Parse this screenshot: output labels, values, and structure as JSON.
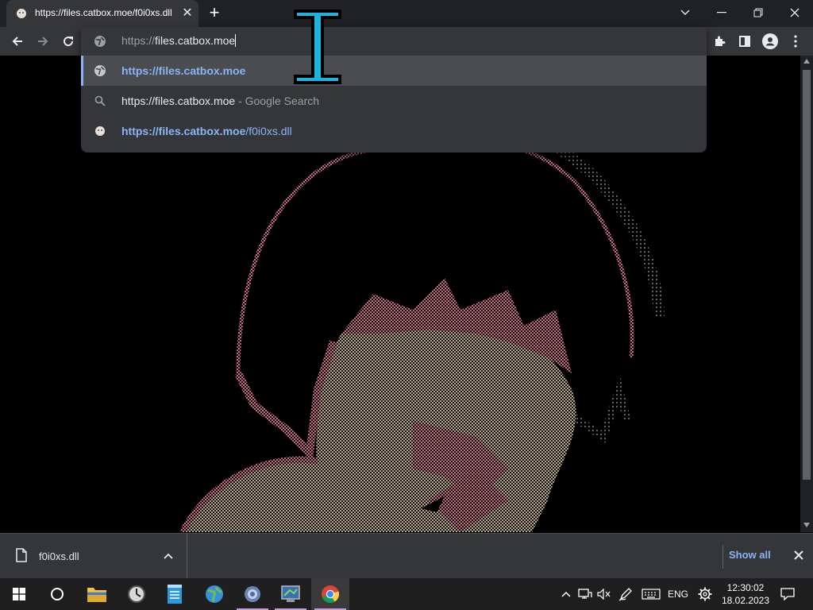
{
  "tab": {
    "title": "https://files.catbox.moe/f0i0xs.dll",
    "close_icon": "close-icon"
  },
  "omnibox": {
    "input_prefix": "https://",
    "input_main": "files.catbox.moe",
    "suggestions": [
      {
        "kind": "url",
        "icon": "globe-icon",
        "text": "https://files.catbox.moe",
        "suffix": "",
        "selected": true
      },
      {
        "kind": "search",
        "icon": "search-icon",
        "text": "https://files.catbox.moe",
        "suffix": " - Google Search",
        "selected": false
      },
      {
        "kind": "history",
        "icon": "catbox-favicon",
        "text_bold": "https://files.catbox.moe",
        "text_rest": "/f0i0xs.dll",
        "selected": false
      }
    ]
  },
  "downloads": {
    "file_name": "f0i0xs.dll",
    "show_all": "Show all"
  },
  "taskbar": {
    "lang": "ENG",
    "time": "12:30:02",
    "date": "18.02.2023"
  },
  "colors": {
    "accent": "#8ab4f8",
    "toolbar": "#35363a",
    "tabstrip": "#202124",
    "taskbar": "#1f1f1f",
    "art_pink": "#d9768f",
    "art_skin": "#c9b89a"
  }
}
